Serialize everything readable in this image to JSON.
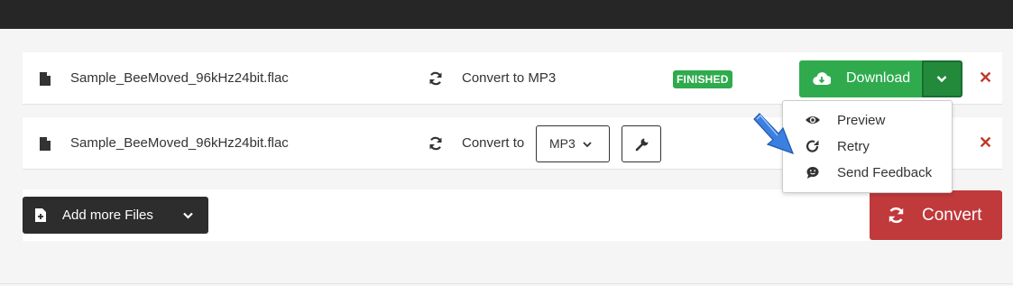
{
  "files": [
    {
      "name": "Sample_BeeMoved_96kHz24bit.flac",
      "convert_label": "Convert to MP3",
      "status": "FINISHED",
      "download_label": "Download"
    },
    {
      "name": "Sample_BeeMoved_96kHz24bit.flac",
      "convert_label": "Convert to",
      "format": "MP3"
    }
  ],
  "download_menu": {
    "items": [
      {
        "label": "Preview",
        "icon": "eye-icon"
      },
      {
        "label": "Retry",
        "icon": "retry-icon"
      },
      {
        "label": "Send Feedback",
        "icon": "feedback-icon"
      }
    ]
  },
  "footer": {
    "add_files_label": "Add more Files",
    "convert_label": "Convert"
  },
  "colors": {
    "success": "#2fab4e",
    "danger": "#c0393b",
    "dark": "#2d2d2d",
    "annotation_arrow": "#3b7fe0"
  }
}
